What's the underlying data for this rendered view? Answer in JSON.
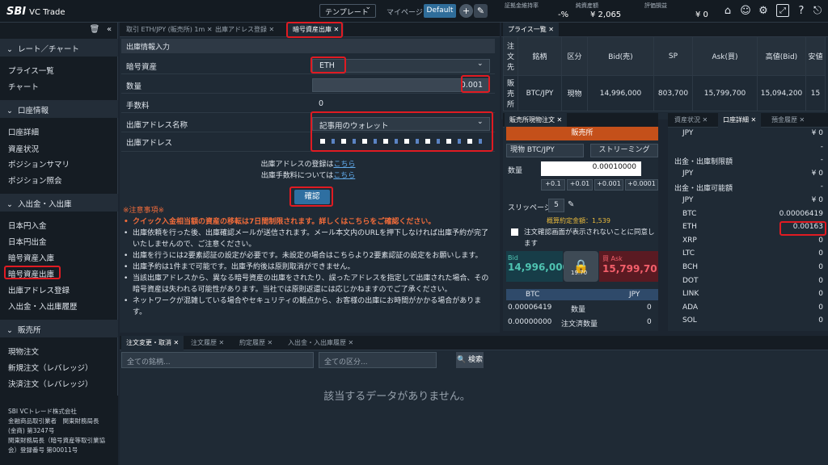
{
  "app": {
    "brand": "SBI",
    "product": "VC Trade",
    "template_label": "テンプレート",
    "mypage_label": "マイページ:",
    "default_label": "Default"
  },
  "stats": [
    {
      "label": "証拠金維持率",
      "value": "-%"
    },
    {
      "label": "純資産額",
      "value": "¥ 2,065"
    },
    {
      "label": "評価損益",
      "value": "¥ 0"
    }
  ],
  "sidebar": {
    "sections": [
      {
        "title": "レート／チャート",
        "items": [
          "プライス一覧",
          "チャート"
        ]
      },
      {
        "title": "口座情報",
        "items": [
          "口座詳細",
          "資産状況",
          "ポジションサマリ",
          "ポジション照会"
        ]
      },
      {
        "title": "入出金・入出庫",
        "items": [
          "日本円入金",
          "日本円出金",
          "暗号資産入庫",
          "暗号資産出庫",
          "出庫アドレス登録",
          "入出金・入出庫履歴"
        ]
      },
      {
        "title": "販売所",
        "items": [
          "現物注文",
          "新規注文（レバレッジ）",
          "決済注文（レバレッジ）"
        ]
      }
    ],
    "footer": [
      "SBI VCトレード株式会社",
      "金融商品取引業者　関東財務局長",
      "(金商) 第3247号",
      "関東財務局長（暗号資産等取引業協",
      "会）登録番号 第00011号"
    ]
  },
  "main_tabs": [
    "取引 ETH/JPY (販売所) 1m",
    "出庫アドレス登録",
    "暗号資産出庫"
  ],
  "form": {
    "header": "出庫情報入力",
    "asset_label": "暗号資産",
    "asset_value": "ETH",
    "qty_label": "数量",
    "qty_value": "0.001",
    "fee_label": "手数料",
    "fee_value": "0",
    "addr_name_label": "出庫アドレス名称",
    "addr_name_value": "記事用のウォレット",
    "addr_label": "出庫アドレス",
    "reg_text": "出庫アドレスの登録は",
    "fee_text": "出庫手数料については",
    "here": "こちら",
    "confirm": "確認"
  },
  "notes": {
    "title": "※注意事項※",
    "items": [
      "クイック入金相当額の資産の移転は7日間制限されます。詳しくはこちらをご確認ください。",
      "出庫依頼を行った後、出庫確認メールが送信されます。メール本文内のURLを押下しなければ出庫予約が完了いたしませんので、ご注意ください。",
      "出庫を行うには2要素認証の設定が必要です。未設定の場合はこちらより2要素認証の設定をお願いします。",
      "出庫予約は1件まで可能です。出庫予約後は原則取消ができません。",
      "当該出庫アドレスから、異なる暗号資産の出庫をされたり、誤ったアドレスを指定して出庫された場合、その暗号資産は失われる可能性があります。当社では原則返還には応じかねますのでご了承ください。",
      "ネットワークが混雑している場合やセキュリティの観点から、お客様の出庫にお時間がかかる場合があります。"
    ]
  },
  "price_list": {
    "tab": "プライス一覧",
    "headers": [
      "注文先",
      "銘柄",
      "区分",
      "Bid(売)",
      "SP",
      "Ask(買)",
      "高値(Bid)",
      "安値"
    ],
    "row": [
      "販売所",
      "BTC/JPY",
      "現物",
      "14,996,000",
      "803,700",
      "15,799,700",
      "15,094,200",
      "15"
    ]
  },
  "order": {
    "tab": "販売所現物注文",
    "header": "販売所",
    "pair": "現物 BTC/JPY",
    "mode": "ストリーミング",
    "qty_label": "数量",
    "qty": "0.00010000",
    "steps": [
      "+0.1",
      "+0.01",
      "+0.001",
      "+0.0001"
    ],
    "slip_label": "スリッページ",
    "slip": "5",
    "est": "概算約定金額：",
    "est_val": "1,539",
    "check": "注文確認画面が表示されないことに同意します",
    "bid_label": "Bid",
    "bid": "14,996,000",
    "ask_label": "買 Ask",
    "ask": "15,799,70",
    "lock": "19.70",
    "bal_h1": "BTC",
    "bal_h2": "JPY",
    "bal_r1": [
      "0.00006419",
      "数量",
      "0"
    ],
    "bal_r2": [
      "0.00000000",
      "注文済数量",
      "0"
    ]
  },
  "account": {
    "tabs": [
      "資産状況",
      "口座詳細",
      "預金履歴"
    ],
    "rows": [
      {
        "k": "JPY",
        "v": "¥ 0",
        "t": "i"
      },
      {
        "k": "",
        "v": "-",
        "t": "i"
      },
      {
        "k": "出金・出庫制限額",
        "v": "-",
        "t": "s"
      },
      {
        "k": "JPY",
        "v": "¥ 0",
        "t": "i"
      },
      {
        "k": "出金・出庫可能額",
        "v": "-",
        "t": "s"
      },
      {
        "k": "JPY",
        "v": "¥ 0",
        "t": "i"
      },
      {
        "k": "BTC",
        "v": "0.00006419",
        "t": "i"
      },
      {
        "k": "ETH",
        "v": "0.00163",
        "t": "i"
      },
      {
        "k": "XRP",
        "v": "0",
        "t": "i"
      },
      {
        "k": "LTC",
        "v": "0",
        "t": "i"
      },
      {
        "k": "BCH",
        "v": "0",
        "t": "i"
      },
      {
        "k": "DOT",
        "v": "0",
        "t": "i"
      },
      {
        "k": "LINK",
        "v": "0",
        "t": "i"
      },
      {
        "k": "ADA",
        "v": "0",
        "t": "i"
      },
      {
        "k": "SOL",
        "v": "0",
        "t": "i"
      }
    ]
  },
  "bottom": {
    "tabs": [
      "注文変更・取消",
      "注文履歴",
      "約定履歴",
      "入出金・入出庫履歴"
    ],
    "sel1": "全ての銘柄...",
    "sel2": "全ての区分...",
    "search": "検索",
    "empty": "該当するデータがありません。"
  }
}
